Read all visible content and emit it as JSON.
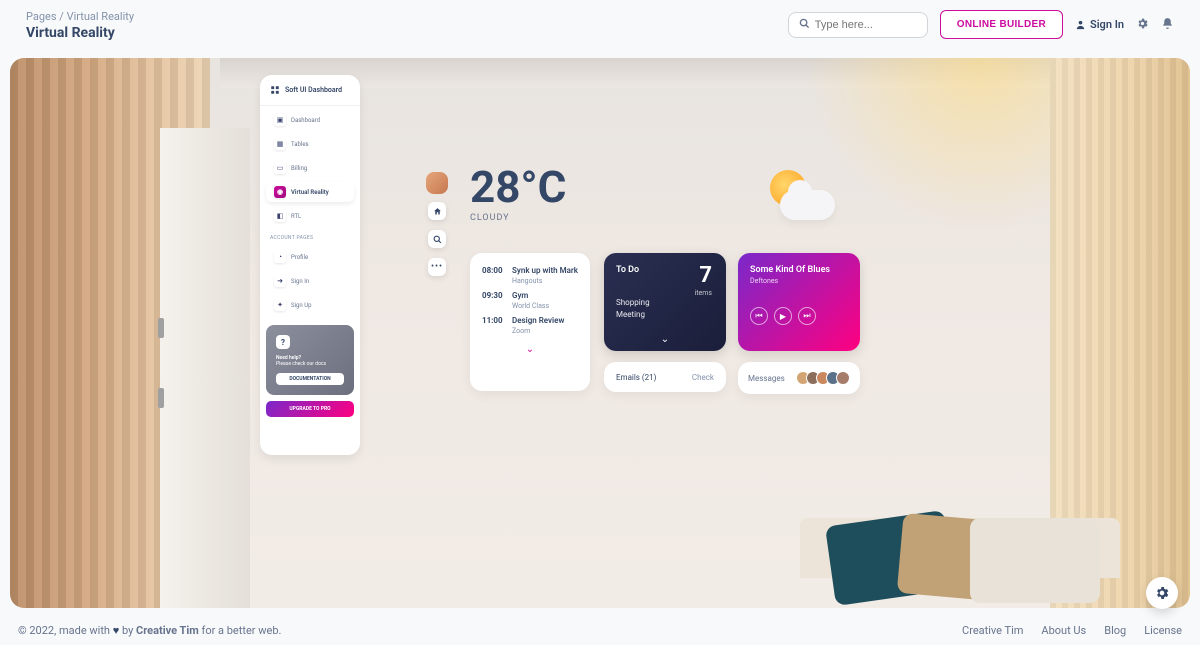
{
  "breadcrumb": {
    "parent": "Pages",
    "sep": "/",
    "current": "Virtual Reality"
  },
  "page_title": "Virtual Reality",
  "search": {
    "placeholder": "Type here..."
  },
  "header": {
    "online_builder": "ONLINE BUILDER",
    "signin": "Sign In"
  },
  "sidenav": {
    "brand": "Soft UI Dashboard",
    "items": [
      {
        "label": "Dashboard"
      },
      {
        "label": "Tables"
      },
      {
        "label": "Billing"
      },
      {
        "label": "Virtual Reality"
      },
      {
        "label": "RTL"
      }
    ],
    "section": "ACCOUNT PAGES",
    "account_items": [
      {
        "label": "Profile"
      },
      {
        "label": "Sign In"
      },
      {
        "label": "Sign Up"
      }
    ],
    "help": {
      "title": "Need help?",
      "sub": "Please check our docs",
      "btn": "DOCUMENTATION"
    },
    "upgrade": "UPGRADE TO PRO"
  },
  "weather": {
    "temp": "28°C",
    "condition": "CLOUDY"
  },
  "schedule": {
    "rows": [
      {
        "time": "08:00",
        "title": "Synk up with Mark",
        "sub": "Hangouts"
      },
      {
        "time": "09:30",
        "title": "Gym",
        "sub": "World Class"
      },
      {
        "time": "11:00",
        "title": "Design Review",
        "sub": "Zoom"
      }
    ]
  },
  "todo": {
    "title": "To Do",
    "count": "7",
    "items_label": "items",
    "list0": "Shopping",
    "list1": "Meeting"
  },
  "emails": {
    "label": "Emails (21)",
    "check": "Check"
  },
  "music": {
    "title": "Some Kind Of Blues",
    "artist": "Deftones"
  },
  "messages": {
    "label": "Messages"
  },
  "footer": {
    "prefix": "© 2022, made with ",
    "by": " by ",
    "brand": "Creative Tim",
    "suffix": " for a better web.",
    "links": {
      "ct": "Creative Tim",
      "about": "About Us",
      "blog": "Blog",
      "license": "License"
    }
  }
}
